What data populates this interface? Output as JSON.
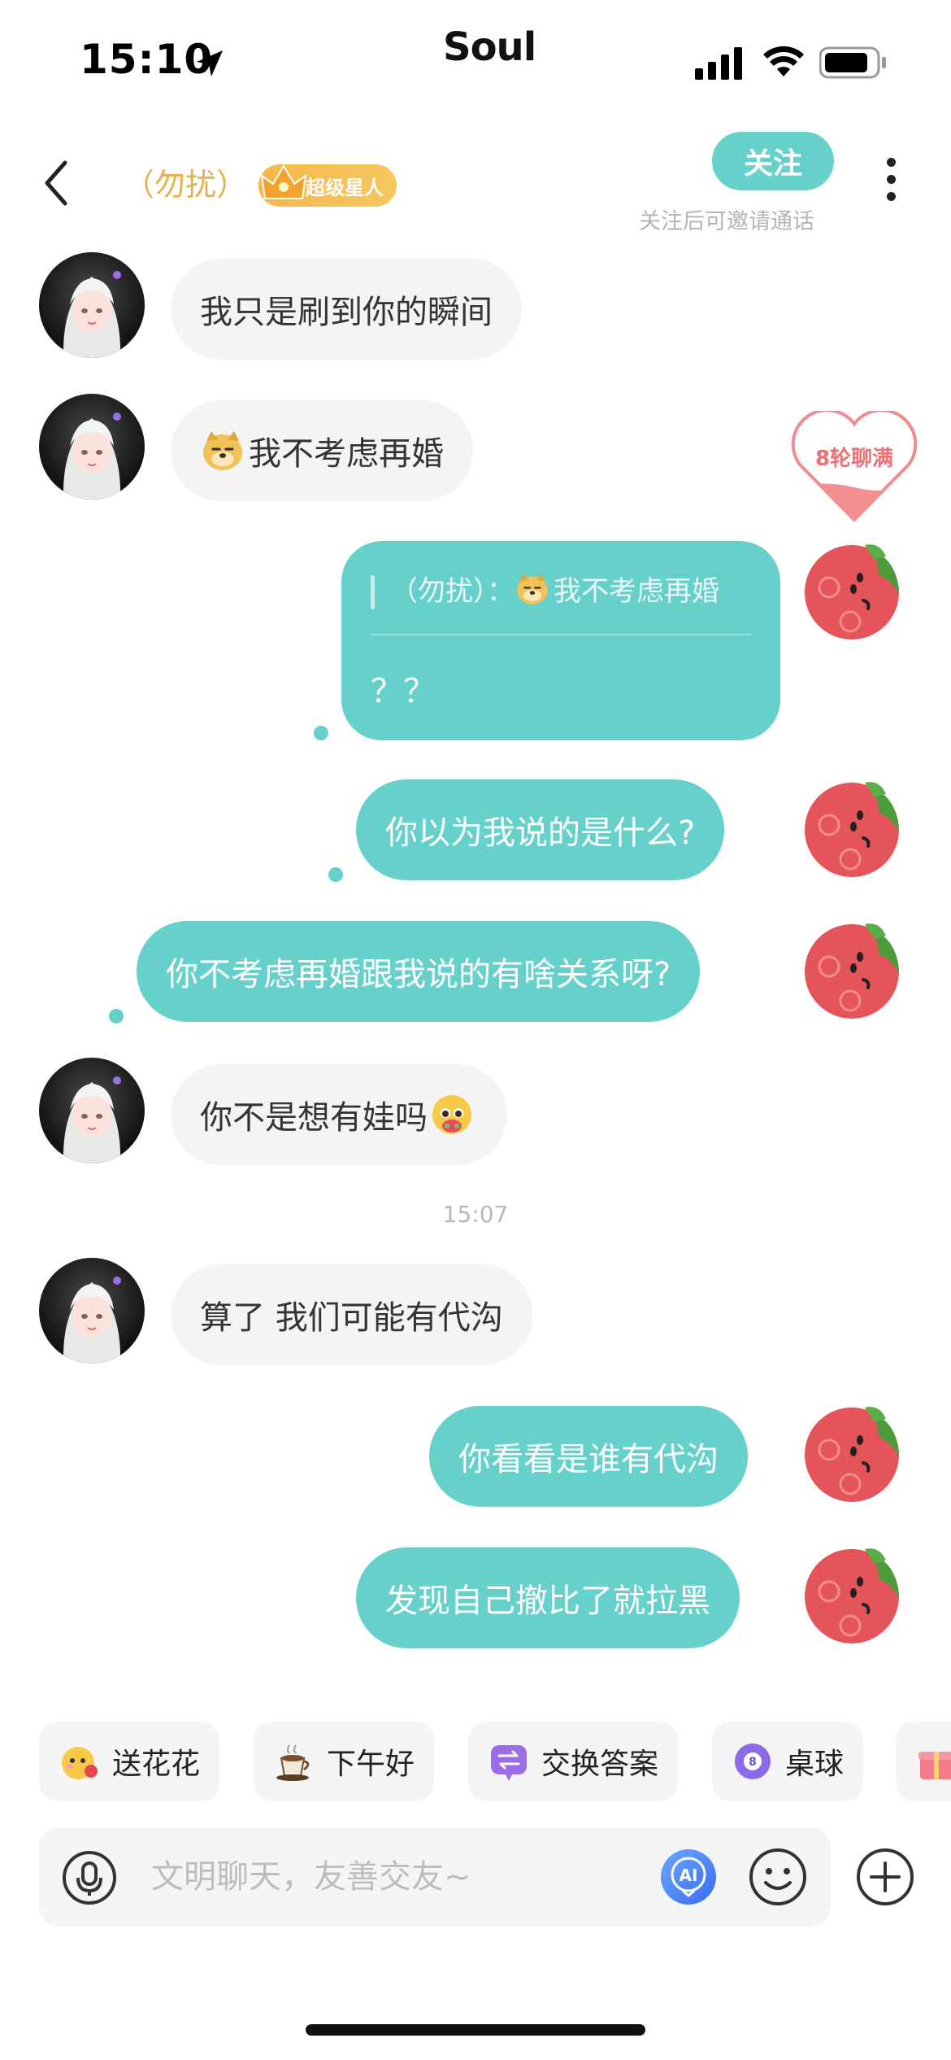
{
  "status_bar": {
    "time": "15:10",
    "carrier": "Soul"
  },
  "header": {
    "nickname": "（勿扰）",
    "badge_label": "超级星人",
    "follow_label": "关注",
    "follow_hint": "关注后可邀请通话"
  },
  "heart_badge": {
    "label": "8轮聊满"
  },
  "messages": [
    {
      "side": "in",
      "text": "我只是刷到你的瞬间"
    },
    {
      "side": "in",
      "text": "我不考虑再婚",
      "emoji": "doge"
    },
    {
      "side": "out",
      "quote": {
        "sender": "（勿扰）：",
        "text": "我不考虑再婚"
      },
      "text": "？？"
    },
    {
      "side": "out",
      "text": "你以为我说的是什么?"
    },
    {
      "side": "out",
      "text": "你不考虑再婚跟我说的有啥关系呀?"
    },
    {
      "side": "in",
      "text": "你不是想有娃吗",
      "emoji": "pleading-face"
    },
    {
      "side": "in",
      "text": "算了 我们可能有代沟"
    },
    {
      "side": "out",
      "text": "你看看是谁有代沟"
    },
    {
      "side": "out",
      "text": "发现自己撤比了就拉黑"
    }
  ],
  "timestamp": "15:07",
  "quick_actions": [
    {
      "label": "送花花",
      "icon": "flower-emoji-icon"
    },
    {
      "label": "下午好",
      "icon": "coffee-icon"
    },
    {
      "label": "交换答案",
      "icon": "swap-icon"
    },
    {
      "label": "桌球",
      "icon": "billiard-ball-icon"
    }
  ],
  "input": {
    "placeholder": "文明聊天，友善交友~"
  },
  "colors": {
    "accent": "#66d0cb",
    "nickname": "#e8b04c",
    "badge": "#f5b74a",
    "heart": "#ef6f73"
  }
}
